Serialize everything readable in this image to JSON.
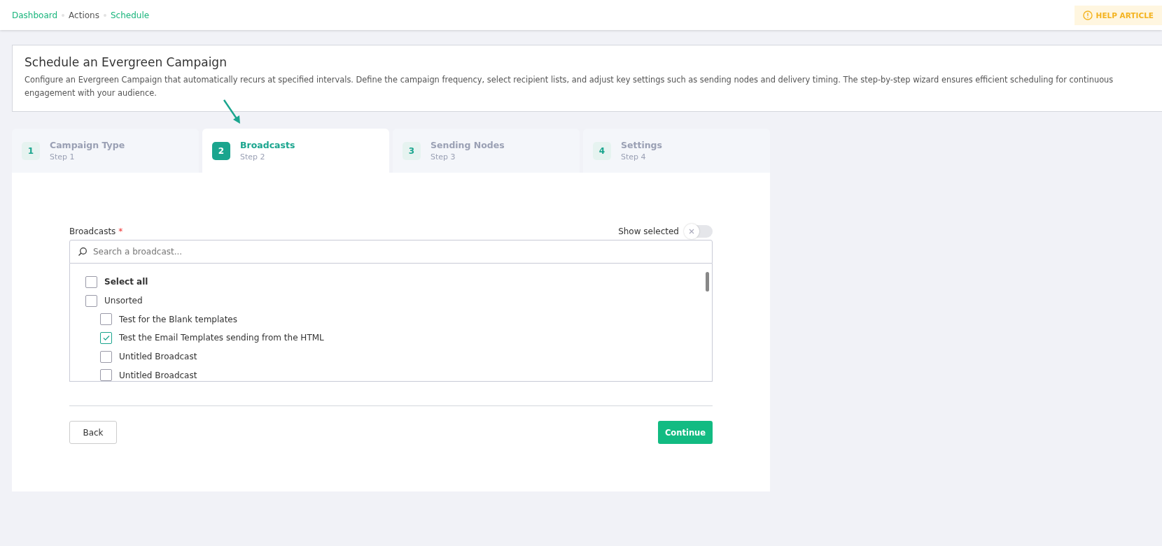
{
  "breadcrumbs": [
    {
      "label": "Dashboard",
      "link": true
    },
    {
      "label": "Actions",
      "link": false
    },
    {
      "label": "Schedule",
      "link": true
    }
  ],
  "help_button": {
    "label": "HELP ARTICLE"
  },
  "intro": {
    "title": "Schedule an Evergreen Campaign",
    "description": "Configure an Evergreen Campaign that automatically recurs at specified intervals. Define the campaign frequency, select recipient lists, and adjust key settings such as sending nodes and delivery timing. The step-by-step wizard ensures efficient scheduling for continuous engagement with your audience."
  },
  "steps": [
    {
      "number": "1",
      "title": "Campaign Type",
      "subtitle": "Step 1",
      "selected": false
    },
    {
      "number": "2",
      "title": "Broadcasts",
      "subtitle": "Step 2",
      "selected": true
    },
    {
      "number": "3",
      "title": "Sending Nodes",
      "subtitle": "Step 3",
      "selected": false
    },
    {
      "number": "4",
      "title": "Settings",
      "subtitle": "Step 4",
      "selected": false
    }
  ],
  "broadcasts": {
    "label": "Broadcasts",
    "required_mark": "*",
    "show_selected": {
      "label": "Show selected",
      "on": false
    },
    "search": {
      "placeholder": "Search a broadcast..."
    },
    "select_all": {
      "label": "Select all",
      "checked": false
    },
    "items": [
      {
        "label": "Unsorted",
        "checked": false,
        "children": [
          {
            "label": "Test for the Blank templates",
            "checked": false
          },
          {
            "label": "Test the Email Templates sending from the HTML",
            "checked": true
          },
          {
            "label": "Untitled Broadcast",
            "checked": false
          },
          {
            "label": "Untitled Broadcast",
            "checked": false
          }
        ]
      }
    ]
  },
  "buttons": {
    "back": "Back",
    "continue": "Continue"
  }
}
